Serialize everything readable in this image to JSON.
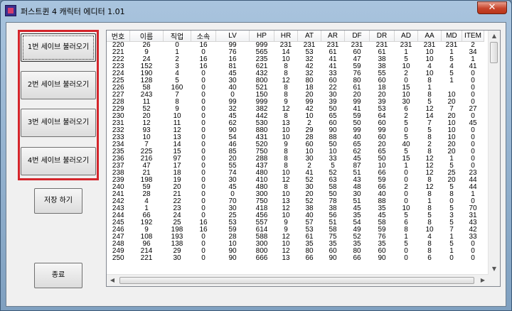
{
  "window": {
    "title": "퍼스트퀸 4 캐릭터 에디터 1.01",
    "close_glyph": "✕"
  },
  "load_buttons": [
    "1번 세이브 불러오기",
    "2번 세이브 불러오기",
    "3번 세이브 불러오기",
    "4번 세이브 불러오기"
  ],
  "save_button": "저장 하기",
  "exit_button": "종료",
  "grid": {
    "columns": [
      "번호",
      "이름",
      "직업",
      "소속",
      "LV",
      "HP",
      "HR",
      "AT",
      "AR",
      "DF",
      "DR",
      "AD",
      "AA",
      "MD",
      "ITEM"
    ],
    "rows": [
      [
        "220",
        "26",
        "0",
        "16",
        "99",
        "999",
        "231",
        "231",
        "231",
        "231",
        "231",
        "231",
        "231",
        "231",
        "2"
      ],
      [
        "221",
        "9",
        "1",
        "0",
        "76",
        "565",
        "14",
        "53",
        "61",
        "60",
        "61",
        "1",
        "10",
        "1",
        "34"
      ],
      [
        "222",
        "24",
        "2",
        "16",
        "16",
        "235",
        "10",
        "32",
        "41",
        "47",
        "38",
        "5",
        "10",
        "5",
        "1"
      ],
      [
        "223",
        "152",
        "3",
        "16",
        "81",
        "621",
        "8",
        "42",
        "41",
        "59",
        "38",
        "10",
        "4",
        "4",
        "41"
      ],
      [
        "224",
        "190",
        "4",
        "0",
        "45",
        "432",
        "8",
        "32",
        "33",
        "76",
        "55",
        "2",
        "10",
        "5",
        "0"
      ],
      [
        "225",
        "128",
        "5",
        "0",
        "30",
        "800",
        "12",
        "80",
        "60",
        "80",
        "60",
        "0",
        "8",
        "1",
        "0"
      ],
      [
        "226",
        "58",
        "160",
        "0",
        "40",
        "521",
        "8",
        "18",
        "22",
        "61",
        "18",
        "15",
        "1",
        "",
        "0"
      ],
      [
        "227",
        "243",
        "7",
        "0",
        "0",
        "150",
        "8",
        "20",
        "30",
        "20",
        "20",
        "10",
        "8",
        "10",
        "0"
      ],
      [
        "228",
        "11",
        "8",
        "0",
        "99",
        "999",
        "9",
        "99",
        "39",
        "99",
        "39",
        "30",
        "5",
        "20",
        "0"
      ],
      [
        "229",
        "52",
        "9",
        "0",
        "32",
        "382",
        "12",
        "42",
        "50",
        "41",
        "53",
        "6",
        "12",
        "7",
        "27"
      ],
      [
        "230",
        "20",
        "10",
        "0",
        "45",
        "442",
        "8",
        "10",
        "65",
        "59",
        "64",
        "2",
        "14",
        "20",
        "0"
      ],
      [
        "231",
        "12",
        "11",
        "0",
        "62",
        "530",
        "13",
        "2",
        "60",
        "50",
        "60",
        "5",
        "7",
        "10",
        "45"
      ],
      [
        "232",
        "93",
        "12",
        "0",
        "90",
        "880",
        "10",
        "29",
        "90",
        "99",
        "99",
        "0",
        "5",
        "10",
        "0"
      ],
      [
        "233",
        "10",
        "13",
        "0",
        "54",
        "431",
        "10",
        "28",
        "88",
        "40",
        "60",
        "5",
        "8",
        "10",
        "0"
      ],
      [
        "234",
        "7",
        "14",
        "0",
        "46",
        "520",
        "9",
        "60",
        "50",
        "65",
        "20",
        "40",
        "2",
        "20",
        "0"
      ],
      [
        "235",
        "225",
        "15",
        "0",
        "85",
        "750",
        "8",
        "10",
        "10",
        "62",
        "65",
        "5",
        "8",
        "20",
        "0"
      ],
      [
        "236",
        "216",
        "97",
        "0",
        "20",
        "288",
        "8",
        "30",
        "33",
        "45",
        "50",
        "15",
        "12",
        "1",
        "0"
      ],
      [
        "237",
        "47",
        "17",
        "0",
        "55",
        "437",
        "8",
        "2",
        "5",
        "87",
        "10",
        "1",
        "12",
        "5",
        "0"
      ],
      [
        "238",
        "21",
        "18",
        "0",
        "74",
        "480",
        "10",
        "41",
        "52",
        "51",
        "66",
        "0",
        "12",
        "25",
        "23"
      ],
      [
        "239",
        "198",
        "19",
        "0",
        "30",
        "410",
        "12",
        "52",
        "63",
        "43",
        "59",
        "0",
        "8",
        "20",
        "44"
      ],
      [
        "240",
        "59",
        "20",
        "0",
        "45",
        "480",
        "8",
        "30",
        "58",
        "48",
        "66",
        "2",
        "12",
        "5",
        "44"
      ],
      [
        "241",
        "28",
        "21",
        "0",
        "0",
        "300",
        "10",
        "20",
        "50",
        "30",
        "40",
        "0",
        "8",
        "8",
        "1"
      ],
      [
        "242",
        "4",
        "22",
        "0",
        "70",
        "750",
        "13",
        "52",
        "78",
        "51",
        "88",
        "0",
        "1",
        "0",
        "0"
      ],
      [
        "243",
        "1",
        "23",
        "0",
        "30",
        "418",
        "12",
        "38",
        "38",
        "45",
        "35",
        "10",
        "8",
        "5",
        "70"
      ],
      [
        "244",
        "66",
        "24",
        "0",
        "25",
        "456",
        "10",
        "40",
        "56",
        "35",
        "45",
        "5",
        "5",
        "3",
        "31"
      ],
      [
        "245",
        "192",
        "25",
        "16",
        "53",
        "557",
        "9",
        "57",
        "51",
        "54",
        "58",
        "6",
        "8",
        "5",
        "43"
      ],
      [
        "246",
        "9",
        "198",
        "16",
        "59",
        "614",
        "9",
        "53",
        "58",
        "49",
        "59",
        "8",
        "10",
        "7",
        "42"
      ],
      [
        "247",
        "108",
        "193",
        "0",
        "28",
        "588",
        "12",
        "61",
        "75",
        "52",
        "76",
        "1",
        "4",
        "1",
        "33"
      ],
      [
        "248",
        "96",
        "138",
        "0",
        "10",
        "300",
        "10",
        "35",
        "35",
        "35",
        "35",
        "5",
        "8",
        "5",
        "0"
      ],
      [
        "249",
        "214",
        "29",
        "0",
        "90",
        "800",
        "12",
        "80",
        "60",
        "80",
        "60",
        "0",
        "8",
        "1",
        "0"
      ],
      [
        "250",
        "221",
        "30",
        "0",
        "90",
        "666",
        "13",
        "66",
        "90",
        "66",
        "90",
        "0",
        "6",
        "0",
        "0"
      ]
    ]
  }
}
